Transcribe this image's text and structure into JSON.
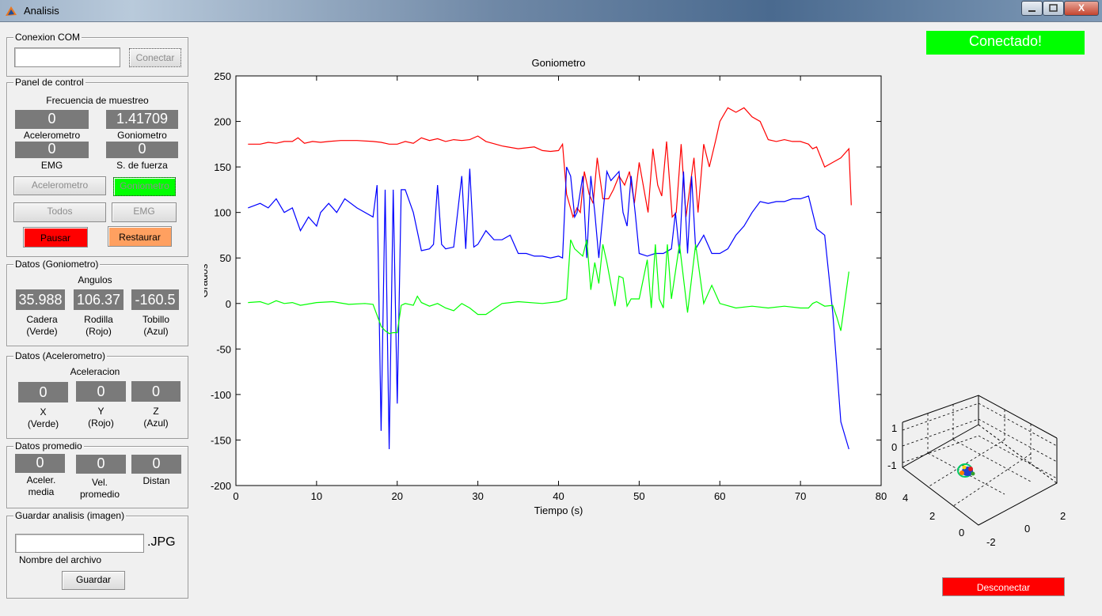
{
  "window": {
    "title": "Analisis",
    "close_glyph": "X"
  },
  "colors": {
    "green": "#00ff00",
    "red": "#ff0000",
    "orange": "#ffa060",
    "value_box": "#7a7a7a",
    "blue": "#0000ff"
  },
  "conexion": {
    "group_title": "Conexion COM",
    "port_value": "",
    "connect_label": "Conectar"
  },
  "control": {
    "group_title": "Panel de control",
    "freq_title": "Frecuencia de muestreo",
    "accel_value": "0",
    "gonio_value": "1.41709",
    "accel_label": "Acelerometro",
    "gonio_label": "Goniometro",
    "emg_value": "0",
    "force_value": "0",
    "emg_label": "EMG",
    "force_label": "S. de fuerza",
    "btn_accel": "Acelerometro",
    "btn_gonio": "Goniometro",
    "btn_all": "Todos",
    "btn_emg": "EMG",
    "btn_pause": "Pausar",
    "btn_restore": "Restaurar"
  },
  "gonio_data": {
    "group_title": "Datos (Goniometro)",
    "subtitle": "Angulos",
    "values": [
      "35.988",
      "106.37",
      "-160.5"
    ],
    "labels": [
      [
        "Cadera",
        "(Verde)"
      ],
      [
        "Rodilla",
        "(Rojo)"
      ],
      [
        "Tobillo",
        "(Azul)"
      ]
    ]
  },
  "accel_data": {
    "group_title": "Datos (Acelerometro)",
    "subtitle": "Aceleracion",
    "values": [
      "0",
      "0",
      "0"
    ],
    "labels": [
      [
        "X",
        "(Verde)"
      ],
      [
        "Y",
        "(Rojo)"
      ],
      [
        "Z",
        "(Azul)"
      ]
    ]
  },
  "avg_data": {
    "group_title": "Datos promedio",
    "values": [
      "0",
      "0",
      "0"
    ],
    "labels": [
      [
        "Aceler.",
        "media"
      ],
      [
        "Vel.",
        "promedio"
      ],
      [
        "Distan",
        ""
      ]
    ]
  },
  "save": {
    "group_title": "Guardar analisis (imagen)",
    "filename_value": "",
    "ext": ".JPG",
    "hint": "Nombre del archivo",
    "button": "Guardar"
  },
  "status": {
    "text": "Conectado!"
  },
  "disconnect": {
    "label": "Desconectar"
  },
  "mini_plot": {
    "z_ticks": [
      "1",
      "0",
      "-1"
    ],
    "y_ticks": [
      "4",
      "2",
      "0"
    ],
    "x_ticks": [
      "2",
      "0",
      "-2"
    ]
  },
  "chart_data": {
    "type": "line",
    "title": "Goniometro",
    "xlabel": "Tiempo (s)",
    "ylabel": "Grados",
    "xlim": [
      0,
      80
    ],
    "ylim": [
      -200,
      250
    ],
    "xticks": [
      0,
      10,
      20,
      30,
      40,
      50,
      60,
      70,
      80
    ],
    "yticks": [
      -200,
      -150,
      -100,
      -50,
      0,
      50,
      100,
      150,
      200,
      250
    ],
    "grid": false,
    "series": [
      {
        "color": "#ff0000",
        "x": [
          1.5,
          3,
          4,
          5,
          6,
          7,
          7.7,
          8.5,
          9.5,
          10.5,
          11.5,
          13,
          15,
          17,
          18,
          19,
          20,
          21,
          22,
          23,
          24,
          25,
          26,
          27,
          28,
          29,
          30,
          31,
          33,
          35,
          37,
          38,
          39,
          40,
          40.5,
          41,
          41.8,
          42.3,
          42.7,
          43.2,
          43.8,
          44.3,
          44.8,
          45.5,
          46.2,
          46.8,
          47.5,
          48.2,
          48.8,
          49.4,
          50,
          50.6,
          51.1,
          51.7,
          52.3,
          52.8,
          53.4,
          54.1,
          54.6,
          55.2,
          55.8,
          56.4,
          56.8,
          57.3,
          58,
          58.7,
          59.5,
          60,
          61,
          62,
          63,
          64,
          65,
          66,
          67,
          68,
          69,
          70,
          71,
          71.5,
          72,
          73,
          74,
          75,
          76,
          76.3
        ],
        "y": [
          175,
          175,
          177,
          176,
          178,
          178,
          182,
          176,
          178,
          177,
          178,
          179,
          179,
          178,
          177,
          175,
          175,
          178,
          176,
          182,
          179,
          181,
          178,
          180,
          179,
          180,
          184,
          178,
          173,
          170,
          172,
          168,
          167,
          168,
          175,
          120,
          95,
          105,
          100,
          145,
          120,
          110,
          160,
          115,
          115,
          125,
          140,
          130,
          145,
          110,
          155,
          125,
          100,
          170,
          130,
          118,
          178,
          95,
          100,
          175,
          95,
          135,
          160,
          100,
          175,
          150,
          180,
          200,
          215,
          210,
          215,
          205,
          200,
          180,
          178,
          180,
          178,
          178,
          175,
          170,
          172,
          150,
          155,
          160,
          170,
          108
        ]
      },
      {
        "color": "#0000ff",
        "x": [
          1.5,
          3,
          4,
          5,
          6,
          7,
          8,
          9,
          10,
          10.5,
          11.5,
          12.5,
          13.5,
          15,
          17,
          17.5,
          18,
          18.5,
          19,
          19.5,
          20,
          20.5,
          21,
          22,
          23,
          24,
          24.5,
          25,
          25.5,
          26,
          27,
          28,
          28.5,
          29,
          29.5,
          30,
          31,
          32,
          33,
          34,
          35,
          36,
          37,
          38,
          39,
          40,
          40.5,
          41,
          41.5,
          42,
          42.3,
          43,
          43.5,
          44,
          44.5,
          45,
          46,
          46.5,
          47,
          47.5,
          48,
          48.5,
          49,
          49.5,
          50,
          51,
          52,
          53,
          54,
          54.5,
          55,
          55.5,
          56,
          56.5,
          57,
          58,
          59,
          60,
          61,
          62,
          63,
          64,
          65,
          66,
          67,
          68,
          69,
          70,
          71,
          72,
          73,
          74,
          75,
          76
        ],
        "y": [
          105,
          110,
          105,
          115,
          100,
          105,
          80,
          95,
          85,
          100,
          110,
          100,
          115,
          105,
          95,
          130,
          -140,
          125,
          -160,
          125,
          -110,
          125,
          125,
          100,
          58,
          60,
          65,
          130,
          65,
          60,
          62,
          140,
          60,
          148,
          62,
          65,
          80,
          70,
          70,
          75,
          55,
          55,
          52,
          52,
          50,
          52,
          50,
          150,
          140,
          95,
          100,
          140,
          50,
          140,
          100,
          50,
          145,
          135,
          140,
          145,
          100,
          85,
          140,
          100,
          55,
          52,
          55,
          55,
          60,
          100,
          55,
          145,
          55,
          140,
          60,
          75,
          55,
          55,
          60,
          75,
          85,
          100,
          112,
          110,
          112,
          112,
          115,
          115,
          118,
          82,
          75,
          -10,
          -130,
          -160
        ]
      },
      {
        "color": "#00ff00",
        "x": [
          1.5,
          3,
          4,
          5,
          6,
          7,
          8,
          10,
          12,
          14,
          16,
          17,
          18,
          18.5,
          19,
          19.5,
          20,
          20.5,
          21,
          22,
          22.5,
          23,
          24,
          25,
          26,
          27,
          28,
          29,
          30,
          31,
          33,
          35,
          38,
          40,
          41,
          41.5,
          42,
          43,
          43.5,
          44,
          44.5,
          45,
          45.5,
          46,
          47,
          47.5,
          48,
          48.5,
          49,
          50,
          51,
          51.5,
          52,
          52.5,
          53,
          53.5,
          54,
          55,
          56,
          57,
          58,
          59,
          60,
          62,
          64,
          66,
          68,
          70,
          71,
          71.5,
          72,
          73,
          74,
          74.5,
          75,
          76
        ],
        "y": [
          1,
          2,
          -1,
          3,
          0,
          1,
          -2,
          1,
          2,
          -1,
          0,
          -1,
          -25,
          -30,
          -33,
          -32,
          -32,
          -2,
          0,
          -2,
          8,
          1,
          -3,
          0,
          -5,
          -8,
          0,
          -5,
          -12,
          -12,
          0,
          2,
          0,
          2,
          5,
          70,
          60,
          52,
          70,
          15,
          45,
          22,
          65,
          45,
          -3,
          30,
          28,
          -3,
          5,
          5,
          48,
          -5,
          65,
          5,
          -5,
          65,
          5,
          65,
          -10,
          65,
          0,
          20,
          0,
          -5,
          -3,
          -5,
          -3,
          -5,
          -5,
          0,
          2,
          -3,
          -2,
          -15,
          -30,
          35
        ]
      }
    ]
  }
}
